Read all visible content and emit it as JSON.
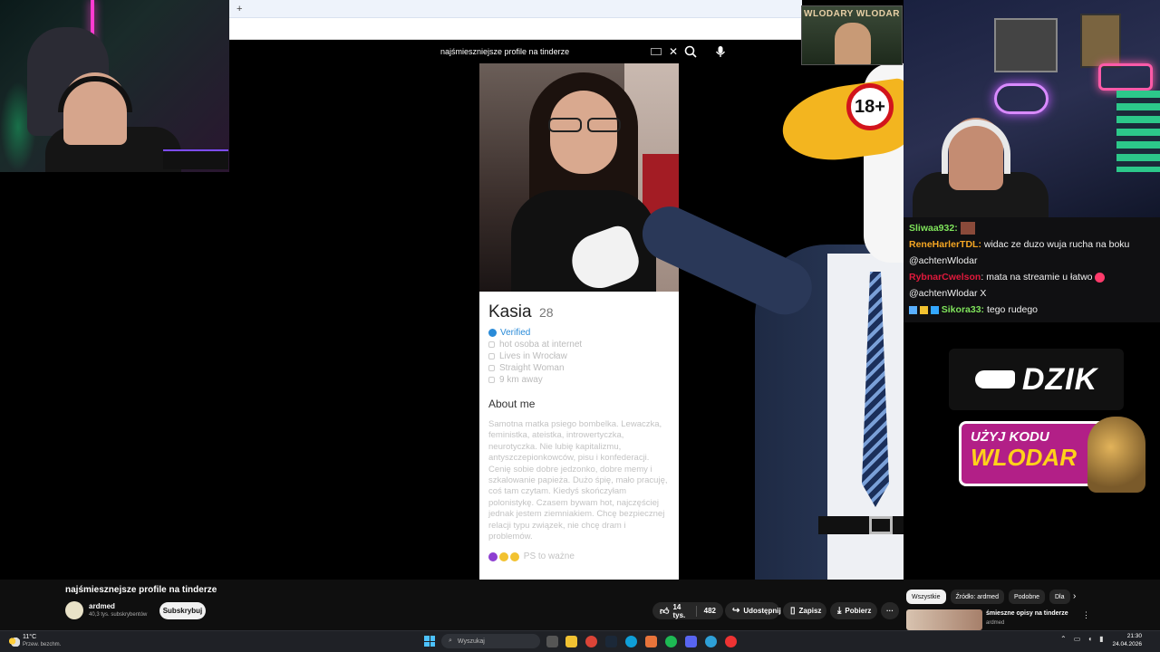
{
  "browser": {
    "new_tab": "+"
  },
  "youtube_search": {
    "query": "najśmieszniejsze profile na tinderze"
  },
  "profile_card": {
    "name": "Kasia",
    "age": "28",
    "verified": "Verified",
    "info": [
      "hot osoba at internet",
      "Lives in Wrocław",
      "Straight Woman",
      "9 km away"
    ],
    "about_title": "About me",
    "about_text": "Samotna matka psiego bombelka. Lewaczka, feministka, ateistka, introwertyczka, neurotyczka. Nie lubię kapitalizmu, antyszczepionkowców, pisu i konfederacji. Cenię sobie dobre jedzonko, dobre memy i szkalowanie papieża. Dużo śpię, mało pracuję, coś tam czytam. Kiedyś skończyłam polonistykę. Czasem bywam hot, najczęściej jednak jestem ziemniakiem. Chcę bezpiecznej relacji typu związek, nie chcę dram i problemów.",
    "footer_note": "PS to ważne"
  },
  "overlay": {
    "age_badge": "18+",
    "banner_text": "WLODARY WLODAR"
  },
  "chat": {
    "messages": [
      {
        "user": "Sliwaa932:",
        "text": "",
        "color": "#7fe35b"
      },
      {
        "user": "ReneHarlerTDL:",
        "text": " widac ze duzo wuja rucha na boku @achtenWlodar",
        "color": "#f5a623"
      },
      {
        "user": "RybnarCwelson",
        "text": ": mata na streamie u łatwo",
        "color": "#e0193c"
      },
      {
        "user": "",
        "text": "@achtenWlodar X",
        "color": "#ffffff"
      },
      {
        "user": "Sikora33:",
        "text": " tego rudego",
        "color": "#7fe35b"
      }
    ]
  },
  "ads": {
    "dzik_logo": "DZIK",
    "promo_line1": "UŻYJ KODU",
    "promo_line2": "WLODAR"
  },
  "video": {
    "title": "najśmiesznejsze profile na tinderze",
    "channel": "ardmed",
    "subscribers": "40,3 tys. subskrybentów",
    "subscribe_label": "Subskrybuj",
    "likes": "14 tys.",
    "dislikes": "482",
    "share_label": "Udostępnij",
    "save_label": "Zapisz",
    "download_label": "Pobierz",
    "more_label": "···"
  },
  "recommendations": {
    "chips": [
      "Wszystkie",
      "Źródło: ardmed",
      "Podobne",
      "Dla"
    ],
    "active_chip": 0,
    "item_title": "śmieszne opisy na tinderze",
    "item_channel": "ardmed"
  },
  "taskbar": {
    "weather_temp": "11°C",
    "weather_desc": "Przew. bezchm.",
    "search_placeholder": "Wyszukaj",
    "time": "21:30",
    "date": "24.04.2026"
  },
  "colors": {
    "accent_blue": "#2a8bd8",
    "promo_bg": "#b21f87",
    "promo_text": "#ffd21a",
    "age_badge_ring": "#d2141c"
  }
}
